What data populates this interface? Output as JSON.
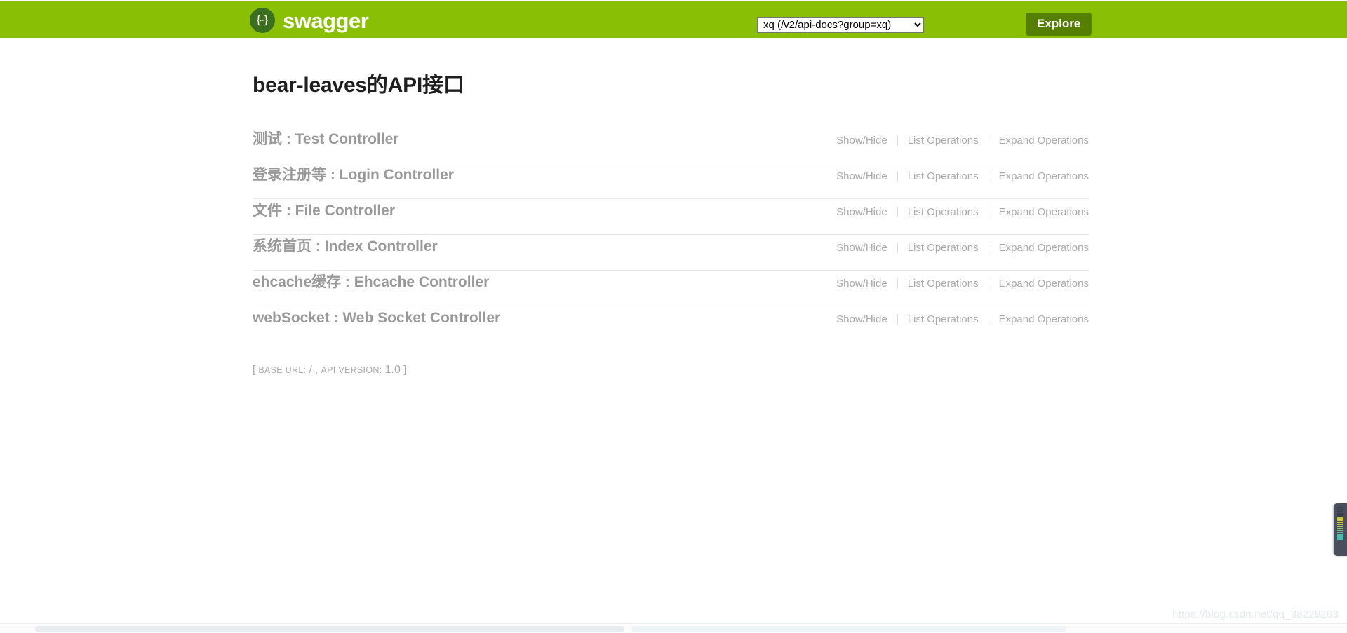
{
  "header": {
    "brand_name": "swagger",
    "logo_icon": "swagger-braces-icon",
    "api_select_value": "xq (/v2/api-docs?group=xq)",
    "api_select_options": [
      "xq (/v2/api-docs?group=xq)"
    ],
    "explore_label": "Explore",
    "background_color": "#89bf04",
    "explore_button_color": "#547f00",
    "logo_circle_color": "#3b6e1f"
  },
  "main": {
    "title": "bear-leaves的API接口",
    "resources": [
      {
        "title": "测试 : Test Controller"
      },
      {
        "title": "登录注册等 : Login Controller"
      },
      {
        "title": "文件 : File Controller"
      },
      {
        "title": "系统首页 : Index Controller"
      },
      {
        "title": "ehcache缓存 : Ehcache Controller"
      },
      {
        "title": "webSocket : Web Socket Controller"
      }
    ],
    "options": {
      "show_hide": "Show/Hide",
      "list_operations": "List Operations",
      "expand_operations": "Expand Operations"
    },
    "api_info": {
      "open_bracket": "[",
      "base_url_label": "BASE URL:",
      "base_url_value": "/",
      "comma": ",",
      "api_version_label": "API VERSION:",
      "api_version_value": "1.0",
      "close_bracket": "]"
    }
  },
  "watermark": {
    "text": "https://blog.csdn.net/qq_38229263"
  },
  "overlay": {
    "level_meter_name": "audio-level-meter"
  }
}
